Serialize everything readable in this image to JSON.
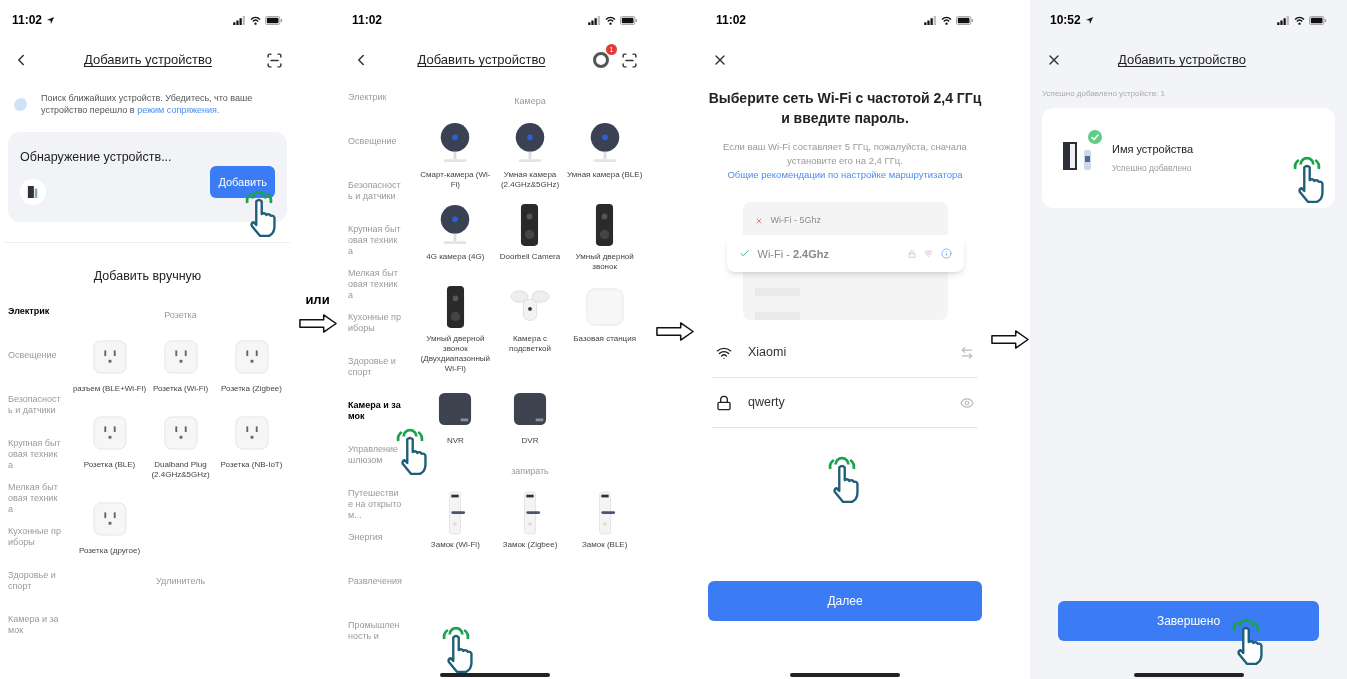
{
  "screen_discovery": {
    "status": {
      "time": "11:02",
      "location_arrow": true
    },
    "title": "Добавить устройство",
    "hint": {
      "text": "Поиск ближайших устройств. Убедитесь, что ваше устройство перешло в",
      "link": "режим сопряжения."
    },
    "discovery_card": {
      "title": "Обнаружение устройств...",
      "button": "Добавить"
    },
    "manual_title": "Добавить вручную",
    "categories": [
      {
        "label": "Электрик",
        "selected": true
      },
      {
        "label": "Освещение",
        "selected": false
      },
      {
        "label": "Безопасность и датчики",
        "selected": false
      },
      {
        "label": "Крупная бытовая техника",
        "selected": false
      },
      {
        "label": "Мелкая бытовая техника",
        "selected": false
      },
      {
        "label": "Кухонные приборы",
        "selected": false
      },
      {
        "label": "Здоровье и спорт",
        "selected": false
      },
      {
        "label": "Камера и замок",
        "selected": false
      }
    ],
    "sections": [
      {
        "title": "Розетка",
        "products": [
          {
            "label": "разъем (BLE+Wi-Fi)",
            "kind": "plug"
          },
          {
            "label": "Розетка (Wi-Fi)",
            "kind": "plug"
          },
          {
            "label": "Розетка (Zigbee)",
            "kind": "plug"
          },
          {
            "label": "Розетка (BLE)",
            "kind": "plug"
          },
          {
            "label": "Dualband Plug (2.4GHz&5GHz)",
            "kind": "plug"
          },
          {
            "label": "Розетка (NB-IoT)",
            "kind": "plug"
          },
          {
            "label": "Розетка (другое)",
            "kind": "plug"
          }
        ]
      },
      {
        "title": "Удлинитель"
      }
    ]
  },
  "or_label": "или",
  "screen_catalog": {
    "status": {
      "time": "11:02",
      "location_arrow": false
    },
    "title": "Добавить устройство",
    "notification_count": "1",
    "categories": [
      {
        "label": "Электрик",
        "selected": false
      },
      {
        "label": "Освещение",
        "selected": false
      },
      {
        "label": "Безопасность и датчики",
        "selected": false
      },
      {
        "label": "Крупная бытовая техника",
        "selected": false
      },
      {
        "label": "Мелкая бытовая техника",
        "selected": false
      },
      {
        "label": "Кухонные приборы",
        "selected": false
      },
      {
        "label": "Здоровье и спорт",
        "selected": false
      },
      {
        "label": "Камера и замок",
        "selected": true
      },
      {
        "label": "Управление шлюзом",
        "selected": false
      },
      {
        "label": "Путешествие на открытом...",
        "selected": false
      },
      {
        "label": "Энергия",
        "selected": false
      },
      {
        "label": "Развлечения",
        "selected": false
      },
      {
        "label": "Промышленность и",
        "selected": false
      }
    ],
    "sections": [
      {
        "title": "Камера",
        "products": [
          {
            "label": "Смарт-камера (Wi-Fi)",
            "kind": "camera"
          },
          {
            "label": "Умная камера (2.4GHz&5GHz)",
            "kind": "camera"
          },
          {
            "label": "Умная камера (BLE)",
            "kind": "camera"
          },
          {
            "label": "4G камера (4G)",
            "kind": "camera"
          },
          {
            "label": "Doorbell Camera",
            "kind": "doorbell"
          },
          {
            "label": "Умный дверной звонок",
            "kind": "doorbell"
          },
          {
            "label": "Умный дверной звонок (Двухдиапазонный Wi-Fi)",
            "kind": "doorbell"
          },
          {
            "label": "Камера с подсветкой",
            "kind": "floodlight"
          },
          {
            "label": "Базовая станция",
            "kind": "base"
          },
          {
            "label": "NVR",
            "kind": "recorder"
          },
          {
            "label": "DVR",
            "kind": "recorder"
          }
        ]
      },
      {
        "title": "запирать",
        "products": [
          {
            "label": "Замок (Wi-Fi)",
            "kind": "lock"
          },
          {
            "label": "Замок (Zigbee)",
            "kind": "lock"
          },
          {
            "label": "Замок (BLE)",
            "kind": "lock"
          }
        ]
      }
    ]
  },
  "screen_wifi": {
    "status": {
      "time": "11:02",
      "location_arrow": false
    },
    "heading": "Выберите сеть Wi-Fi с частотой 2,4 ГГц и введите пароль.",
    "note": {
      "text": "Если ваш Wi-Fi составляет 5 ГГц, пожалуйста, сначала установите его на 2,4 ГГц.",
      "link": "Общие рекомендации по настройке маршрутизатора"
    },
    "bands": [
      {
        "label": "Wi-Fi - 5Ghz",
        "valid": false
      },
      {
        "label": "Wi-Fi - **2.4Ghz**",
        "valid": true
      }
    ],
    "fields": [
      {
        "kind": "network",
        "value": "Xiaomi"
      },
      {
        "kind": "password",
        "value": "qwerty"
      }
    ],
    "button": "Далее"
  },
  "screen_done": {
    "status": {
      "time": "10:52",
      "location_arrow": true
    },
    "title": "Добавить устройство",
    "summary": "Успешно добавлено устройств: 1",
    "device": {
      "name": "Имя устройства",
      "status": "Успешно добавлено"
    },
    "button": "Завершено"
  }
}
